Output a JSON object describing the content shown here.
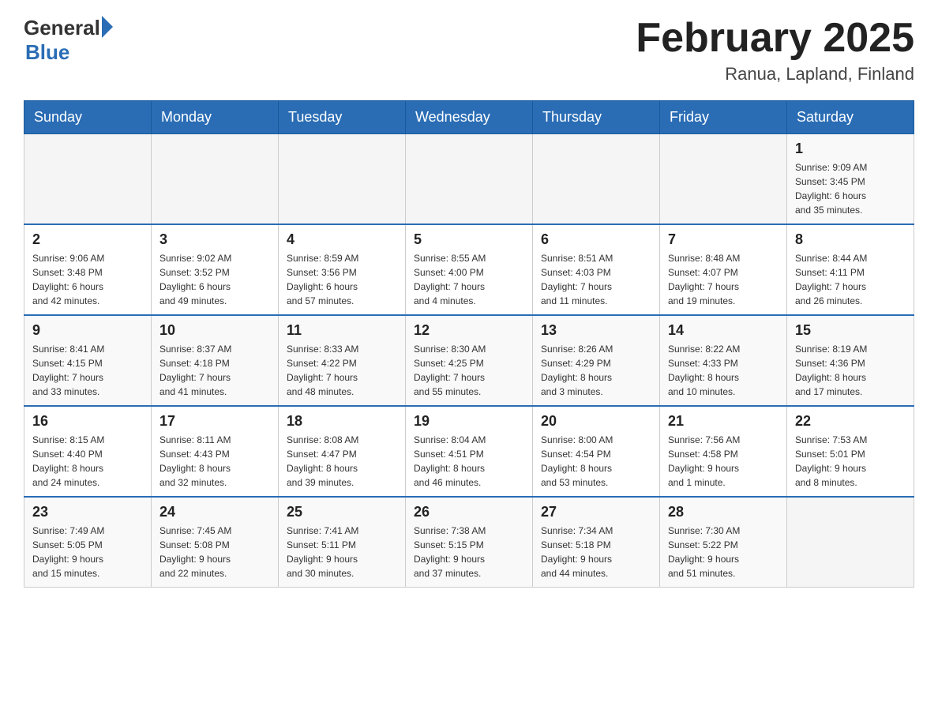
{
  "header": {
    "title": "February 2025",
    "subtitle": "Ranua, Lapland, Finland",
    "logo_general": "General",
    "logo_blue": "Blue"
  },
  "days_of_week": [
    "Sunday",
    "Monday",
    "Tuesday",
    "Wednesday",
    "Thursday",
    "Friday",
    "Saturday"
  ],
  "weeks": [
    [
      {
        "day": "",
        "info": ""
      },
      {
        "day": "",
        "info": ""
      },
      {
        "day": "",
        "info": ""
      },
      {
        "day": "",
        "info": ""
      },
      {
        "day": "",
        "info": ""
      },
      {
        "day": "",
        "info": ""
      },
      {
        "day": "1",
        "info": "Sunrise: 9:09 AM\nSunset: 3:45 PM\nDaylight: 6 hours\nand 35 minutes."
      }
    ],
    [
      {
        "day": "2",
        "info": "Sunrise: 9:06 AM\nSunset: 3:48 PM\nDaylight: 6 hours\nand 42 minutes."
      },
      {
        "day": "3",
        "info": "Sunrise: 9:02 AM\nSunset: 3:52 PM\nDaylight: 6 hours\nand 49 minutes."
      },
      {
        "day": "4",
        "info": "Sunrise: 8:59 AM\nSunset: 3:56 PM\nDaylight: 6 hours\nand 57 minutes."
      },
      {
        "day": "5",
        "info": "Sunrise: 8:55 AM\nSunset: 4:00 PM\nDaylight: 7 hours\nand 4 minutes."
      },
      {
        "day": "6",
        "info": "Sunrise: 8:51 AM\nSunset: 4:03 PM\nDaylight: 7 hours\nand 11 minutes."
      },
      {
        "day": "7",
        "info": "Sunrise: 8:48 AM\nSunset: 4:07 PM\nDaylight: 7 hours\nand 19 minutes."
      },
      {
        "day": "8",
        "info": "Sunrise: 8:44 AM\nSunset: 4:11 PM\nDaylight: 7 hours\nand 26 minutes."
      }
    ],
    [
      {
        "day": "9",
        "info": "Sunrise: 8:41 AM\nSunset: 4:15 PM\nDaylight: 7 hours\nand 33 minutes."
      },
      {
        "day": "10",
        "info": "Sunrise: 8:37 AM\nSunset: 4:18 PM\nDaylight: 7 hours\nand 41 minutes."
      },
      {
        "day": "11",
        "info": "Sunrise: 8:33 AM\nSunset: 4:22 PM\nDaylight: 7 hours\nand 48 minutes."
      },
      {
        "day": "12",
        "info": "Sunrise: 8:30 AM\nSunset: 4:25 PM\nDaylight: 7 hours\nand 55 minutes."
      },
      {
        "day": "13",
        "info": "Sunrise: 8:26 AM\nSunset: 4:29 PM\nDaylight: 8 hours\nand 3 minutes."
      },
      {
        "day": "14",
        "info": "Sunrise: 8:22 AM\nSunset: 4:33 PM\nDaylight: 8 hours\nand 10 minutes."
      },
      {
        "day": "15",
        "info": "Sunrise: 8:19 AM\nSunset: 4:36 PM\nDaylight: 8 hours\nand 17 minutes."
      }
    ],
    [
      {
        "day": "16",
        "info": "Sunrise: 8:15 AM\nSunset: 4:40 PM\nDaylight: 8 hours\nand 24 minutes."
      },
      {
        "day": "17",
        "info": "Sunrise: 8:11 AM\nSunset: 4:43 PM\nDaylight: 8 hours\nand 32 minutes."
      },
      {
        "day": "18",
        "info": "Sunrise: 8:08 AM\nSunset: 4:47 PM\nDaylight: 8 hours\nand 39 minutes."
      },
      {
        "day": "19",
        "info": "Sunrise: 8:04 AM\nSunset: 4:51 PM\nDaylight: 8 hours\nand 46 minutes."
      },
      {
        "day": "20",
        "info": "Sunrise: 8:00 AM\nSunset: 4:54 PM\nDaylight: 8 hours\nand 53 minutes."
      },
      {
        "day": "21",
        "info": "Sunrise: 7:56 AM\nSunset: 4:58 PM\nDaylight: 9 hours\nand 1 minute."
      },
      {
        "day": "22",
        "info": "Sunrise: 7:53 AM\nSunset: 5:01 PM\nDaylight: 9 hours\nand 8 minutes."
      }
    ],
    [
      {
        "day": "23",
        "info": "Sunrise: 7:49 AM\nSunset: 5:05 PM\nDaylight: 9 hours\nand 15 minutes."
      },
      {
        "day": "24",
        "info": "Sunrise: 7:45 AM\nSunset: 5:08 PM\nDaylight: 9 hours\nand 22 minutes."
      },
      {
        "day": "25",
        "info": "Sunrise: 7:41 AM\nSunset: 5:11 PM\nDaylight: 9 hours\nand 30 minutes."
      },
      {
        "day": "26",
        "info": "Sunrise: 7:38 AM\nSunset: 5:15 PM\nDaylight: 9 hours\nand 37 minutes."
      },
      {
        "day": "27",
        "info": "Sunrise: 7:34 AM\nSunset: 5:18 PM\nDaylight: 9 hours\nand 44 minutes."
      },
      {
        "day": "28",
        "info": "Sunrise: 7:30 AM\nSunset: 5:22 PM\nDaylight: 9 hours\nand 51 minutes."
      },
      {
        "day": "",
        "info": ""
      }
    ]
  ]
}
